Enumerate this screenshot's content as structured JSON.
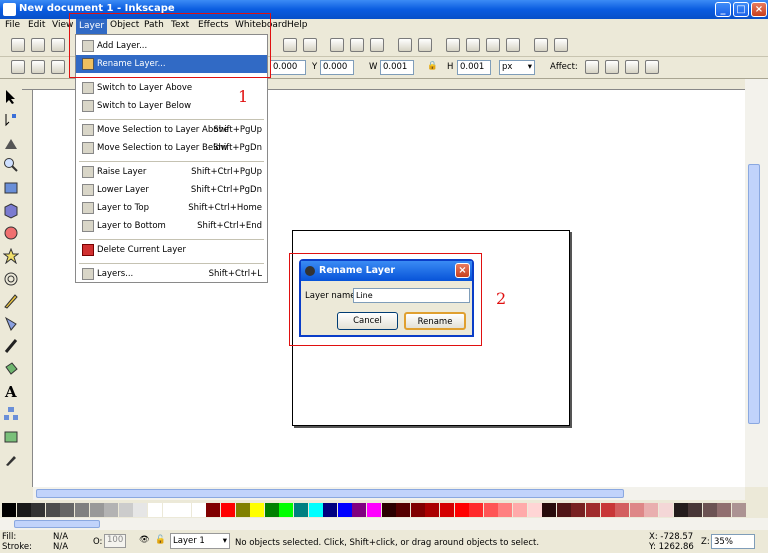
{
  "window": {
    "title": "New document 1 - Inkscape"
  },
  "menubar": [
    "File",
    "Edit",
    "View",
    "Layer",
    "Object",
    "Path",
    "Text",
    "Effects",
    "Whiteboard",
    "Help"
  ],
  "toolbar2": {
    "x_label": "X",
    "x_value": "0.000",
    "y_label": "Y",
    "y_value": "0.000",
    "w_label": "W",
    "w_value": "0.001",
    "h_label": "H",
    "h_value": "0.001",
    "unit": "px",
    "affect_label": "Affect:"
  },
  "layer_menu": {
    "items": [
      {
        "label": "Add Layer...",
        "shortcut": ""
      },
      {
        "label": "Rename Layer...",
        "shortcut": "",
        "selected": true
      },
      {
        "label": "Switch to Layer Above",
        "shortcut": ""
      },
      {
        "label": "Switch to Layer Below",
        "shortcut": ""
      },
      {
        "label": "Move Selection to Layer Above",
        "shortcut": "Shift+PgUp"
      },
      {
        "label": "Move Selection to Layer Below",
        "shortcut": "Shift+PgDn"
      },
      {
        "label": "Raise Layer",
        "shortcut": "Shift+Ctrl+PgUp"
      },
      {
        "label": "Lower Layer",
        "shortcut": "Shift+Ctrl+PgDn"
      },
      {
        "label": "Layer to Top",
        "shortcut": "Shift+Ctrl+Home"
      },
      {
        "label": "Layer to Bottom",
        "shortcut": "Shift+Ctrl+End"
      },
      {
        "label": "Delete Current Layer",
        "shortcut": ""
      },
      {
        "label": "Layers...",
        "shortcut": "Shift+Ctrl+L"
      }
    ]
  },
  "annotations": {
    "one": "1",
    "two": "2"
  },
  "dialog": {
    "title": "Rename Layer",
    "field_label": "Layer name:",
    "field_value": "Line",
    "cancel": "Cancel",
    "rename": "Rename"
  },
  "palette": [
    "#000000",
    "#1a1a1a",
    "#333333",
    "#4d4d4d",
    "#666666",
    "#808080",
    "#999999",
    "#b3b3b3",
    "#cccccc",
    "#e6e6e6",
    "#ffffff",
    "#ffffff",
    "#ffffff",
    "#ffffff",
    "#800000",
    "#ff0000",
    "#808000",
    "#ffff00",
    "#008000",
    "#00ff00",
    "#008080",
    "#00ffff",
    "#000080",
    "#0000ff",
    "#800080",
    "#ff00ff",
    "#2b0000",
    "#550000",
    "#800000",
    "#aa0000",
    "#d40000",
    "#ff0000",
    "#ff2a2a",
    "#ff5555",
    "#ff8080",
    "#ffaaaa",
    "#ffd5d5",
    "#280b0b",
    "#501616",
    "#782121",
    "#a02c2c",
    "#c83737",
    "#d35f5f",
    "#de8787",
    "#e9afaf",
    "#f4d7d7",
    "#241c1c",
    "#483737",
    "#6c5353",
    "#916f6f",
    "#ac9393"
  ],
  "status": {
    "fill_label": "Fill:",
    "fill_value": "N/A",
    "stroke_label": "Stroke:",
    "stroke_value": "N/A",
    "opacity_label": "O:",
    "opacity_value": "100",
    "layer": "Layer 1",
    "message": "No objects selected. Click, Shift+click, or drag around objects to select.",
    "x_coord": "X: -728.57",
    "y_coord": "Y: 1262.86",
    "zoom_label": "Z:",
    "zoom": "35%"
  }
}
